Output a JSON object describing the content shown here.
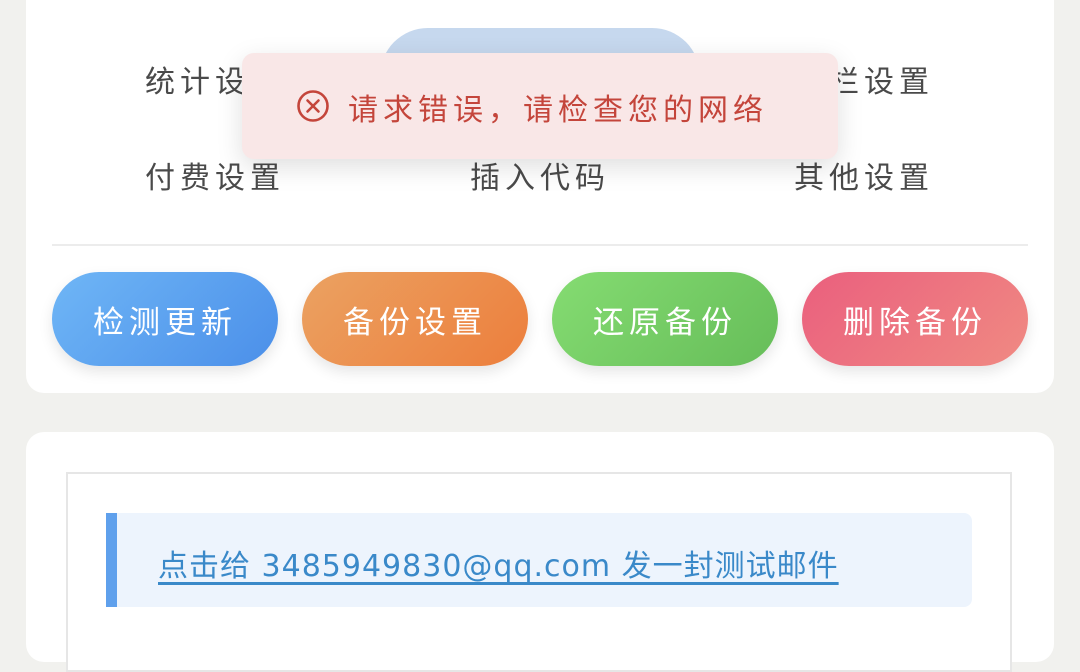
{
  "settings_nav": {
    "row1": [
      "统计设",
      "",
      "栏设置"
    ],
    "row2": [
      "付费设置",
      "插入代码",
      "其他设置"
    ]
  },
  "actions": {
    "check_update": "检测更新",
    "backup_settings": "备份设置",
    "restore_backup": "还原备份",
    "delete_backup": "删除备份"
  },
  "toast": {
    "icon": "error-circle-x-icon",
    "message": "请求错误，请检查您的网络",
    "color": "#c4453b"
  },
  "mail_test": {
    "link_text": "点击给 3485949830@qq.com 发一封测试邮件"
  },
  "colors": {
    "check_update": "#4b8fe9",
    "backup_settings": "#ec7e3c",
    "restore_backup": "#66bd59",
    "delete_backup": "#ea5f7e",
    "active_tab": "#c6d8ee"
  }
}
